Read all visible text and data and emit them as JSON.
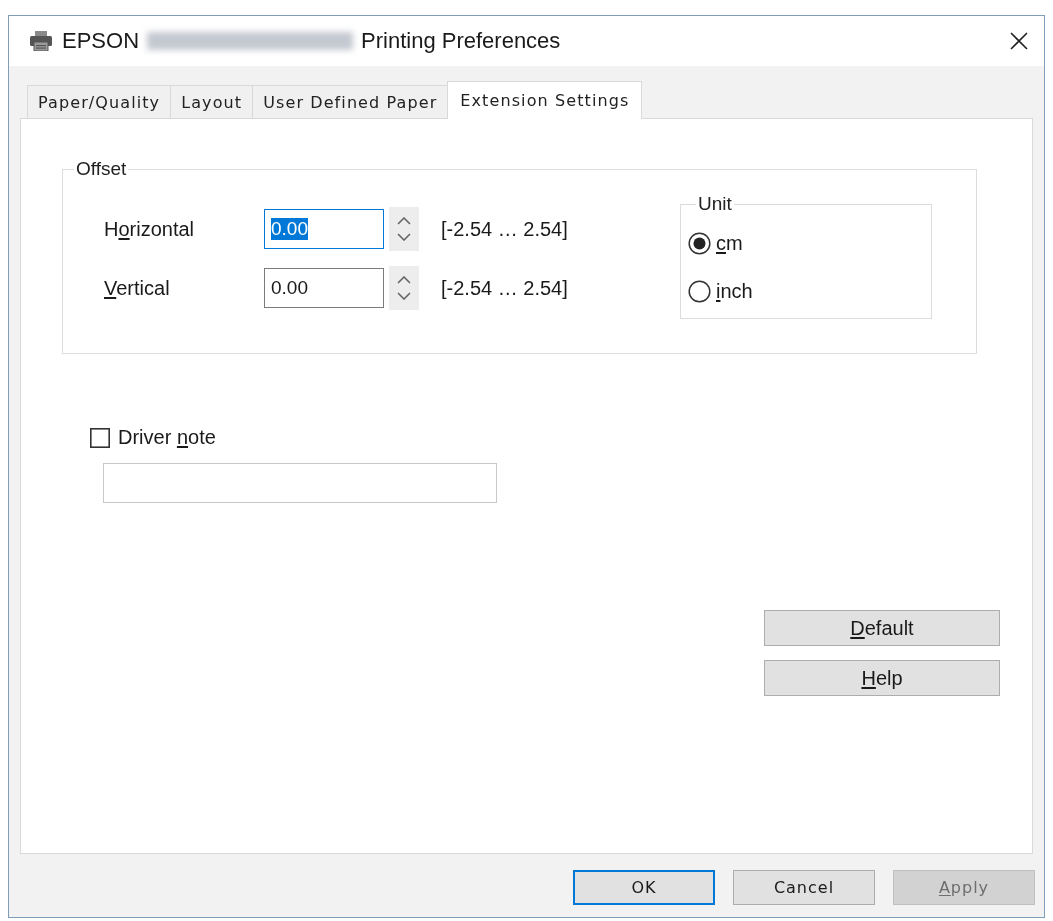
{
  "window": {
    "title_start": "EPSON",
    "title_end": "Printing Preferences"
  },
  "tabs": [
    {
      "label": "Paper/Quality",
      "selected": false
    },
    {
      "label": "Layout",
      "selected": false
    },
    {
      "label": "User Defined Paper",
      "selected": false
    },
    {
      "label": "Extension Settings",
      "selected": true
    }
  ],
  "offset": {
    "legend": "Offset",
    "fields": [
      {
        "label": [
          {
            "text": "H",
            "underlined": false
          },
          {
            "text": "o",
            "underlined": true
          },
          {
            "text": "rizontal",
            "underlined": false
          }
        ],
        "value": "0.00",
        "focused": true,
        "range": "[-2.54 … 2.54]"
      },
      {
        "label": [
          {
            "text": "V",
            "underlined": true
          },
          {
            "text": "ertical",
            "underlined": false
          }
        ],
        "value": "0.00",
        "focused": false,
        "range": "[-2.54 … 2.54]"
      }
    ]
  },
  "unit": {
    "legend": "Unit",
    "options": [
      {
        "label": [
          {
            "text": "c",
            "underlined": true
          },
          {
            "text": "m",
            "underlined": false
          }
        ],
        "selected": true
      },
      {
        "label": [
          {
            "text": "i",
            "underlined": true
          },
          {
            "text": "nch",
            "underlined": false
          }
        ],
        "selected": false
      }
    ]
  },
  "driver_note": {
    "label": [
      {
        "text": "Driver ",
        "underlined": false
      },
      {
        "text": "n",
        "underlined": true
      },
      {
        "text": "ote",
        "underlined": false
      }
    ],
    "checked": false
  },
  "side_buttons": [
    {
      "label": [
        {
          "text": "D",
          "underlined": true
        },
        {
          "text": "efault",
          "underlined": false
        }
      ]
    },
    {
      "label": [
        {
          "text": "H",
          "underlined": true
        },
        {
          "text": "elp",
          "underlined": false
        }
      ]
    }
  ],
  "footer_buttons": [
    {
      "label": [
        {
          "text": "OK",
          "underlined": false
        }
      ],
      "default": true,
      "disabled": false
    },
    {
      "label": [
        {
          "text": "Cancel",
          "underlined": false
        }
      ],
      "default": false,
      "disabled": false
    },
    {
      "label": [
        {
          "text": "A",
          "underlined": true
        },
        {
          "text": "pply",
          "underlined": false
        }
      ],
      "default": false,
      "disabled": true
    }
  ]
}
